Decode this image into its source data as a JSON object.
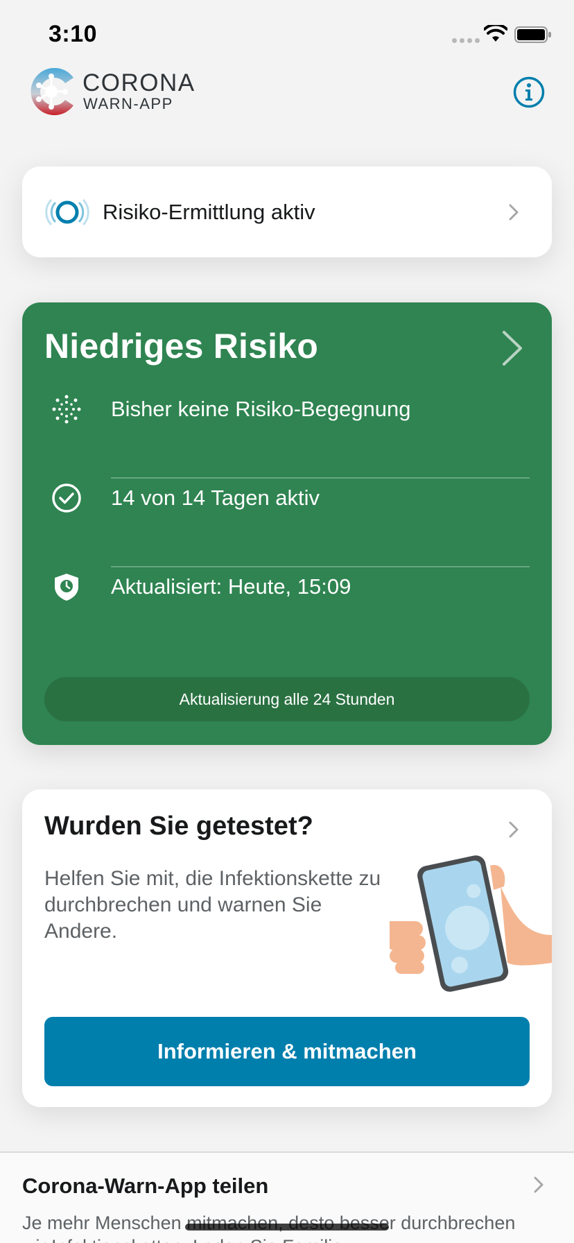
{
  "status_bar": {
    "time": "3:10"
  },
  "header": {
    "logo_line1": "CORONA",
    "logo_line2": "WARN-APP",
    "info_icon": "info-circle-icon"
  },
  "tracing": {
    "label": "Risiko-Ermittlung aktiv",
    "icon": "tracing-active-icon"
  },
  "risk": {
    "title": "Niedriges Risiko",
    "color": "#2f8451",
    "rows": [
      {
        "icon": "virus-dots-icon",
        "text": "Bisher keine Risiko-Begegnung"
      },
      {
        "icon": "checkmark-circle-icon",
        "text": "14 von 14 Tagen aktiv"
      },
      {
        "icon": "shield-clock-icon",
        "text": "Aktualisiert: Heute, 15:09"
      }
    ],
    "update_interval": "Aktualisierung alle 24 Stunden"
  },
  "test": {
    "title": "Wurden Sie getestet?",
    "body": "Helfen Sie mit, die Infektionskette zu durchbrechen und warnen Sie Andere.",
    "button_label": "Informieren & mitmachen",
    "accent": "#007fad"
  },
  "share": {
    "title": "Corona-Warn-App teilen",
    "body": "Je mehr Menschen mitmachen, desto besser durchbrechen wir Infektionsketten. Laden Sie Familie"
  }
}
